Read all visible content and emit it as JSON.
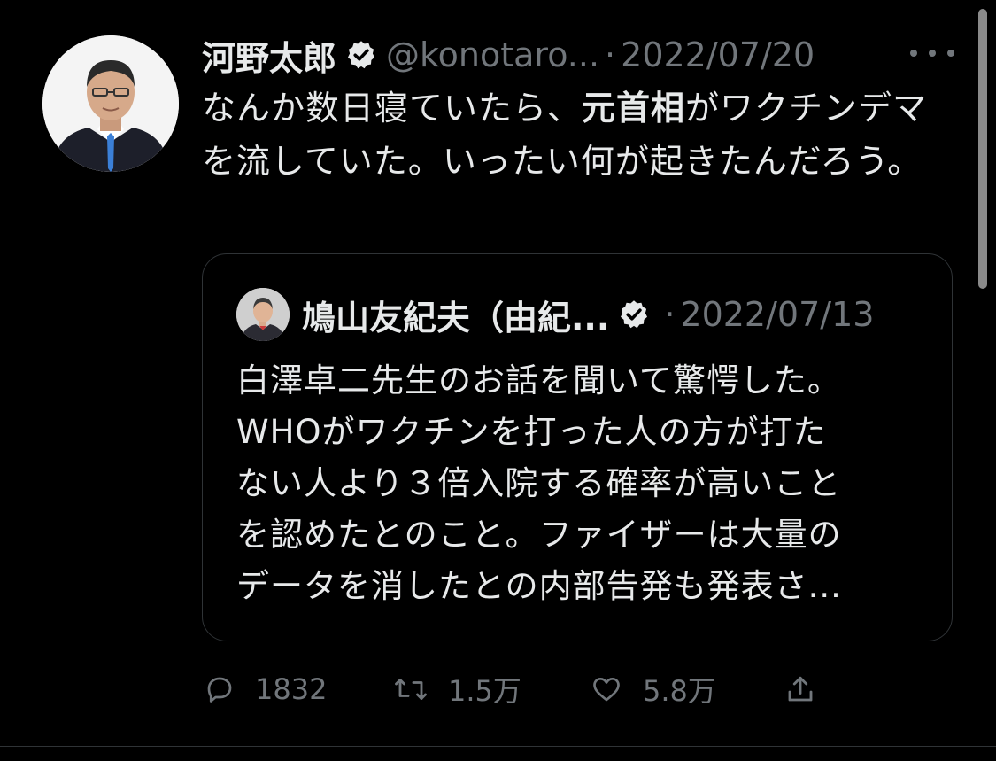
{
  "tweet": {
    "author_name": "河野太郎",
    "handle": "@konotaro...",
    "separator": "·",
    "date": "2022/07/20",
    "text_part1": "なんか数日寝ていたら、",
    "text_bold": "元首相",
    "text_part2": "がワクチンデマを流していた。いったい何が起きたんだろう。"
  },
  "quoted": {
    "author_name": "鳩山友紀夫（由紀...",
    "separator": "·",
    "date": "2022/07/13",
    "lines": [
      "白澤卓二先生のお話を聞いて驚愕した。",
      "WHOがワクチンを打った人の方が打た",
      "ない人より３倍入院する確率が高いこと",
      "を認めたとのこと。ファイザーは大量の",
      "データを消したとの内部告発も発表さ..."
    ]
  },
  "actions": {
    "reply_count": "1832",
    "retweet_count": "1.5万",
    "like_count": "5.8万"
  },
  "icons": {
    "verified": "verified-badge-icon",
    "more": "more-options-icon",
    "reply": "reply-icon",
    "retweet": "retweet-icon",
    "like": "heart-icon",
    "share": "share-icon"
  },
  "colors": {
    "background": "#000000",
    "text": "#e7e9ea",
    "secondary": "#71767b",
    "border": "#2f3336"
  }
}
